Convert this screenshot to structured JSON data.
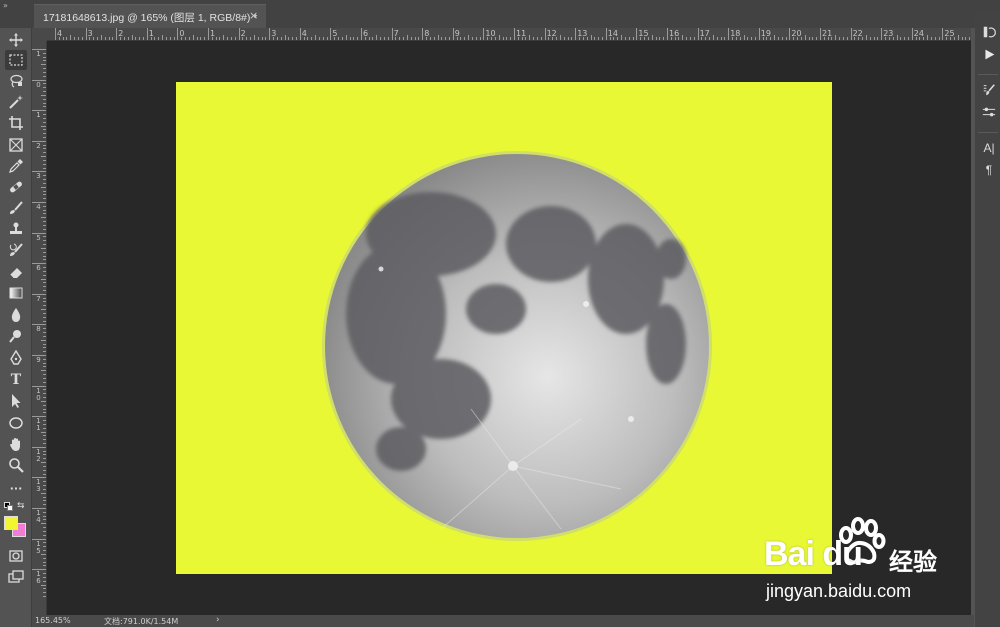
{
  "document": {
    "tab_title": "17181648613.jpg @ 165% (图层 1, RGB/8#) *",
    "close_glyph": "×"
  },
  "ruler": {
    "top_labels": [
      "4",
      "3",
      "2",
      "1",
      "0",
      "1",
      "2",
      "3",
      "4",
      "5",
      "6",
      "7",
      "8",
      "9",
      "10",
      "11",
      "12",
      "13",
      "14",
      "15",
      "16",
      "17",
      "18",
      "19",
      "20",
      "21",
      "22",
      "23",
      "24",
      "25"
    ],
    "left_labels": [
      "1",
      "0",
      "1",
      "2",
      "3",
      "4",
      "5",
      "6",
      "7",
      "8",
      "9",
      "1\n0",
      "1\n1",
      "1\n2",
      "1\n3",
      "1\n4",
      "1\n5",
      "1\n6"
    ]
  },
  "toolbar": {
    "tools": [
      "move-tool",
      "marquee-tool",
      "lasso-tool",
      "magic-wand-tool",
      "crop-tool",
      "frame-tool",
      "eyedropper-tool",
      "healing-brush-tool",
      "brush-tool",
      "clone-stamp-tool",
      "history-brush-tool",
      "eraser-tool",
      "gradient-tool",
      "blur-tool",
      "dodge-tool",
      "pen-tool",
      "type-tool",
      "path-selection-tool",
      "ellipse-tool",
      "hand-tool",
      "zoom-tool",
      "more-tools"
    ],
    "type_tool_glyph": "T",
    "more_glyph": "···"
  },
  "colors": {
    "foreground": "#f2f531",
    "background": "#f07fd3",
    "canvas_fill": "#e9f834"
  },
  "status": {
    "zoom": "165.45%",
    "doc_info": "文档:791.0K/1.54M",
    "arrow": "›"
  },
  "right_panel": {
    "type_glyph": "A|",
    "paragraph_glyph": "¶"
  },
  "watermark": {
    "brand": "Bai du",
    "cn": "经验",
    "url": "jingyan.baidu.com"
  }
}
